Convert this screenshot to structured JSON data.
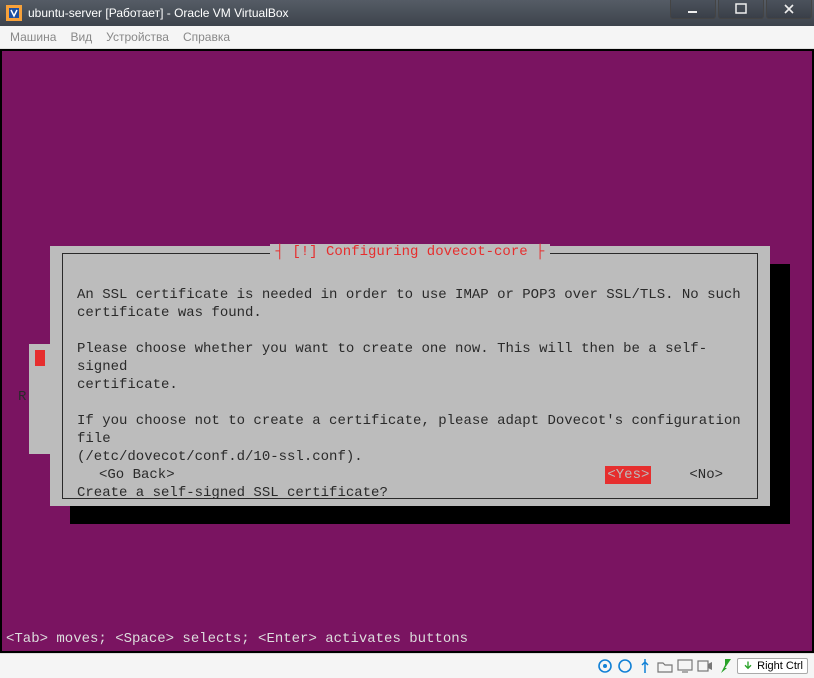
{
  "window": {
    "title": "ubuntu-server [Работает] - Oracle VM VirtualBox"
  },
  "menu": {
    "machine": "Машина",
    "view": "Вид",
    "devices": "Устройства",
    "help": "Справка"
  },
  "dialog": {
    "title": "┤ [!] Configuring dovecot-core ├",
    "para1": "An SSL certificate is needed in order to use IMAP or POP3 over SSL/TLS. No such\ncertificate was found.",
    "para2": "Please choose whether you want to create one now. This will then be a self-signed\ncertificate.",
    "para3": "If you choose not to create a certificate, please adapt Dovecot's configuration file\n(/etc/dovecot/conf.d/10-ssl.conf).",
    "para4": "Create a self-signed SSL certificate?",
    "goback": "<Go Back>",
    "yes": "<Yes>",
    "no": "<No>"
  },
  "behind_r": "R",
  "hint": "<Tab> moves; <Space> selects; <Enter> activates buttons",
  "status": {
    "hostkey": "Right Ctrl"
  }
}
